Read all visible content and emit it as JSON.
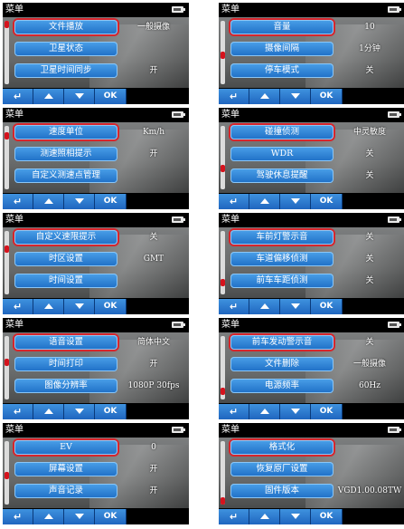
{
  "screens": [
    {
      "title": "菜单",
      "items": [
        {
          "label": "文件播放",
          "value": "一般摄像"
        },
        {
          "label": "卫星状态",
          "value": ""
        },
        {
          "label": "卫星时间同步",
          "value": "开"
        }
      ],
      "selected": 0
    },
    {
      "title": "菜单",
      "items": [
        {
          "label": "音量",
          "value": "10"
        },
        {
          "label": "摄像间隔",
          "value": "1分钟"
        },
        {
          "label": "停车模式",
          "value": "关"
        }
      ],
      "selected": 0
    },
    {
      "title": "菜单",
      "items": [
        {
          "label": "速度单位",
          "value": "Km/h"
        },
        {
          "label": "测速照相提示",
          "value": "开"
        },
        {
          "label": "自定义测速点管理",
          "value": ""
        }
      ],
      "selected": 0
    },
    {
      "title": "菜单",
      "items": [
        {
          "label": "碰撞侦测",
          "value": "中灵敏度"
        },
        {
          "label": "WDR",
          "value": "关"
        },
        {
          "label": "驾驶休息提醒",
          "value": "关"
        }
      ],
      "selected": 0
    },
    {
      "title": "菜单",
      "items": [
        {
          "label": "自定义速限提示",
          "value": "关"
        },
        {
          "label": "时区设置",
          "value": "GMT"
        },
        {
          "label": "时间设置",
          "value": ""
        }
      ],
      "selected": 0
    },
    {
      "title": "菜单",
      "items": [
        {
          "label": "车前灯警示音",
          "value": "关"
        },
        {
          "label": "车道偏移侦测",
          "value": "关"
        },
        {
          "label": "前车车距侦测",
          "value": "关"
        }
      ],
      "selected": 0
    },
    {
      "title": "菜单",
      "items": [
        {
          "label": "语音设置",
          "value": "简体中文"
        },
        {
          "label": "时间打印",
          "value": "开"
        },
        {
          "label": "图像分辨率",
          "value": "1080P 30fps"
        }
      ],
      "selected": 0
    },
    {
      "title": "菜单",
      "items": [
        {
          "label": "前车发动警示音",
          "value": "关"
        },
        {
          "label": "文件删除",
          "value": "一般摄像"
        },
        {
          "label": "电源频率",
          "value": "60Hz"
        }
      ],
      "selected": 0
    },
    {
      "title": "菜单",
      "items": [
        {
          "label": "EV",
          "value": "0"
        },
        {
          "label": "屏幕设置",
          "value": "开"
        },
        {
          "label": "声音记录",
          "value": "开"
        }
      ],
      "selected": 0
    },
    {
      "title": "菜单",
      "items": [
        {
          "label": "格式化",
          "value": ""
        },
        {
          "label": "恢复原厂设置",
          "value": ""
        },
        {
          "label": "固件版本",
          "value": "VGD1.00.08TW"
        }
      ],
      "selected": 0
    }
  ],
  "scroll_positions": [
    0.0,
    0.55,
    0.12,
    0.7,
    0.25,
    0.85,
    0.4,
    0.92,
    0.55,
    1.0
  ],
  "toolbar": {
    "ok_label": "OK"
  },
  "icons": {
    "back": "back-arrow-icon",
    "up": "up-arrow-icon",
    "down": "down-arrow-icon",
    "battery": "battery-icon"
  },
  "colors": {
    "button_blue": "#1f6fc7",
    "selection_red": "#d7252c",
    "header_black": "#000000"
  }
}
